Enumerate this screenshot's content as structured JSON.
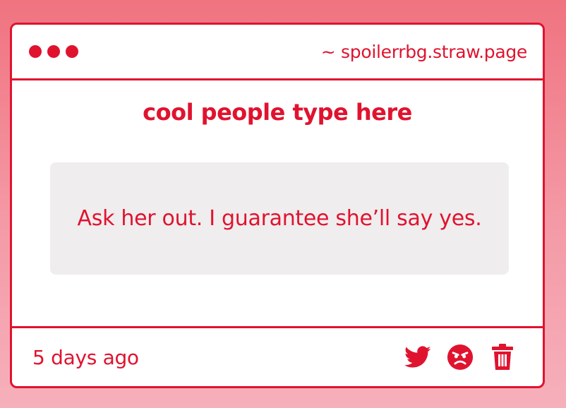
{
  "titlebar": {
    "url": "~ spoilerrbg.straw.page"
  },
  "content": {
    "heading": "cool people type here",
    "message": "Ask her out. I guarantee she’ll say yes."
  },
  "footer": {
    "time": "5 days ago",
    "actions": [
      {
        "icon": "twitter-icon"
      },
      {
        "icon": "angry-face-icon"
      },
      {
        "icon": "trash-icon"
      }
    ]
  },
  "colors": {
    "accent": "#e0132f",
    "message_bg": "#efedee",
    "bg_top": "#f07380",
    "bg_bottom": "#f6b0bb"
  }
}
